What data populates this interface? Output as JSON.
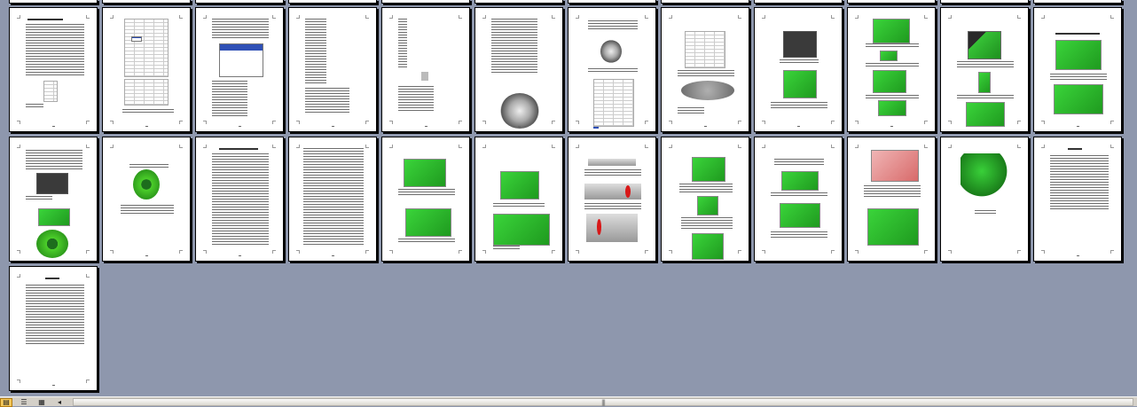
{
  "statusbar": {
    "view_buttons": [
      {
        "name": "print-layout-view-icon",
        "glyph": "▤"
      },
      {
        "name": "outline-view-icon",
        "glyph": "☰"
      },
      {
        "name": "reading-view-icon",
        "glyph": "▦"
      }
    ],
    "scroll_left_glyph": "◂",
    "scroll_grip_glyph": "|||"
  },
  "colors": {
    "workspace": "#8e97ad",
    "page": "#ffffff",
    "render_green": "#2fbf2f",
    "active_view": "#f6c95a"
  }
}
